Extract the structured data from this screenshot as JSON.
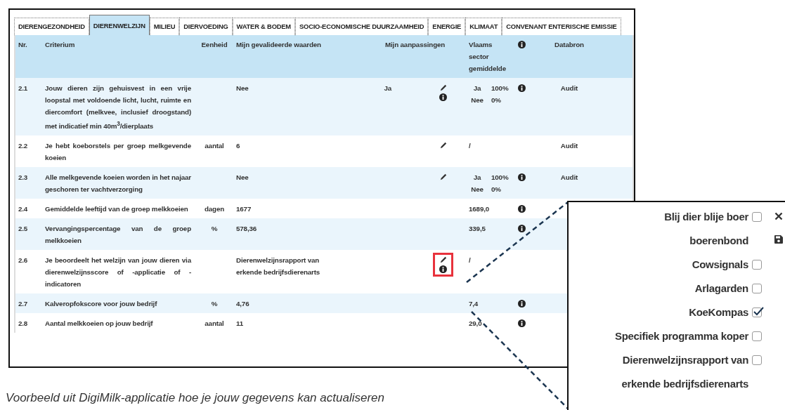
{
  "tabs": [
    {
      "label": "DIERENGEZONDHEID",
      "selected": false
    },
    {
      "label": "DIERENWELZIJN",
      "selected": true
    },
    {
      "label": "MILIEU",
      "selected": false
    },
    {
      "label": "DIERVOEDING",
      "selected": false
    },
    {
      "label": "WATER & BODEM",
      "selected": false
    },
    {
      "label": "SOCIO-ECONOMISCHE DUURZAAMHEID",
      "selected": false
    },
    {
      "label": "ENERGIE",
      "selected": false
    },
    {
      "label": "KLIMAAT",
      "selected": false
    },
    {
      "label": "CONVENANT ENTERISCHE EMISSIE",
      "selected": false
    }
  ],
  "table": {
    "columns": {
      "nr": "Nr.",
      "criterium": "Criterium",
      "unit": "Eenheid",
      "validated": "Mijn gevalideerde waarden",
      "adjustments": "Mijn aanpassingen",
      "sector": "Vlaams sector gemiddelde",
      "source": "Databron"
    },
    "rows": [
      {
        "nr": "2.1",
        "criterium": "Jouw dieren zijn gehuisvest in een vrije loopstal met voldoende licht, lucht, ruimte en diercomfort (melkvee, inclusief droogstand) met indicatief min 40m$^{3}$/dierplaats",
        "unit": "",
        "validated": "Nee",
        "adjustment": "Ja",
        "editable": true,
        "adjust_info": true,
        "highlighted": false,
        "sector": [
          {
            "value": "Ja",
            "share": "100%"
          },
          {
            "value": "Nee",
            "share": "0%"
          }
        ],
        "sector_info": true,
        "source": "Audit"
      },
      {
        "nr": "2.2",
        "criterium": "Je hebt koeborstels per groep melkgevende koeien",
        "unit": "aantal",
        "validated": "6",
        "adjustment": "",
        "editable": true,
        "adjust_info": false,
        "highlighted": false,
        "sector": [
          {
            "value": "/"
          }
        ],
        "sector_info": false,
        "source": "Audit"
      },
      {
        "nr": "2.3",
        "criterium": "Alle melkgevende koeien worden in het najaar geschoren ter vachtverzorging",
        "unit": "",
        "validated": "Nee",
        "adjustment": "",
        "editable": true,
        "adjust_info": false,
        "highlighted": false,
        "sector": [
          {
            "value": "Ja",
            "share": "100%"
          },
          {
            "value": "Nee",
            "share": "0%"
          }
        ],
        "sector_info": true,
        "source": "Audit"
      },
      {
        "nr": "2.4",
        "criterium": "Gemiddelde leeftijd van de groep melkkoeien",
        "unit": "dagen",
        "validated": "1677",
        "adjustment": "",
        "editable": false,
        "adjust_info": false,
        "highlighted": false,
        "sector": [
          {
            "value": "1689,0"
          }
        ],
        "sector_info": true,
        "source": ""
      },
      {
        "nr": "2.5",
        "criterium": "Vervangingspercentage van de groep melkkoeien",
        "unit": "%",
        "validated": "578,36",
        "adjustment": "",
        "editable": false,
        "adjust_info": false,
        "highlighted": false,
        "sector": [
          {
            "value": "339,5"
          }
        ],
        "sector_info": true,
        "source": ""
      },
      {
        "nr": "2.6",
        "criterium": "Je beoordeelt het welzijn van jouw dieren via dierenwelzijnsscore of -applicatie of -indicatoren",
        "unit": "",
        "validated": "Dierenwelzijnsrapport van erkende bedrijfsdierenarts",
        "adjustment": "",
        "editable": true,
        "adjust_info": true,
        "highlighted": true,
        "sector": [
          {
            "value": "/"
          }
        ],
        "sector_info": false,
        "source": ""
      },
      {
        "nr": "2.7",
        "criterium": "Kalveropfokscore voor jouw bedrijf",
        "unit": "%",
        "validated": "4,76",
        "adjustment": "",
        "editable": false,
        "adjust_info": false,
        "highlighted": false,
        "sector": [
          {
            "value": "7,4"
          }
        ],
        "sector_info": true,
        "source": ""
      },
      {
        "nr": "2.8",
        "criterium": "Aantal melkkoeien op jouw bedrijf",
        "unit": "aantal",
        "validated": "11",
        "adjustment": "",
        "editable": false,
        "adjust_info": false,
        "highlighted": false,
        "sector": [
          {
            "value": "29,0"
          }
        ],
        "sector_info": true,
        "source": ""
      }
    ]
  },
  "popup": {
    "options": [
      {
        "lines": [
          "Blij dier blije boer",
          "boerenbond"
        ],
        "checked": false
      },
      {
        "lines": [
          "Cowsignals"
        ],
        "checked": false
      },
      {
        "lines": [
          "Arlagarden"
        ],
        "checked": false
      },
      {
        "lines": [
          "KoeKompas"
        ],
        "checked": true
      },
      {
        "lines": [
          "Specifiek programma koper"
        ],
        "checked": false
      },
      {
        "lines": [
          "Dierenwelzijnsrapport van",
          "erkende bedrijfsdierenarts"
        ],
        "checked": false
      }
    ]
  },
  "caption": "Voorbeeld uit DigiMilk-applicatie hoe je jouw gegevens kan actualiseren"
}
